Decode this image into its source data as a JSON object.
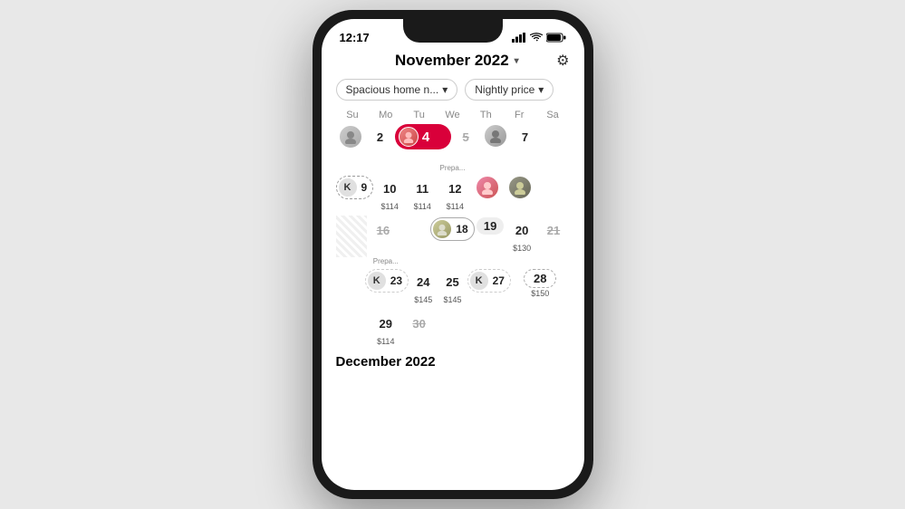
{
  "phone": {
    "status_bar": {
      "time": "12:17",
      "signal": "▐▐▐",
      "wifi": "wifi",
      "battery": "battery"
    },
    "header": {
      "month_title": "November 2022",
      "chevron": "ᵛ",
      "gear_label": "⚙"
    },
    "filters": [
      {
        "label": "Spacious home n...",
        "chevron": "∨"
      },
      {
        "label": "Nightly price",
        "chevron": "∨"
      }
    ],
    "calendar_headers": [
      "Su",
      "Mo",
      "Tu",
      "We",
      "Th",
      "Fr",
      "Sa"
    ],
    "december_label": "December 2022",
    "weeks": [
      {
        "type": "row1",
        "cells": [
          {
            "day": "",
            "type": "avatar",
            "avatar_color": "#bbb"
          },
          {
            "day": "2",
            "type": "normal"
          },
          {
            "day": "4",
            "type": "active",
            "avatar": true
          },
          {
            "day": "5",
            "type": "strikethrough"
          },
          {
            "day": "",
            "type": "avatar-right",
            "avatar_color": "#bbb"
          },
          {
            "day": "7",
            "type": "normal"
          },
          {
            "day": "",
            "type": "empty"
          }
        ]
      }
    ],
    "rows": {
      "row_week1_sub": {
        "label": "Prepa...",
        "col": 4
      },
      "week2": [
        {
          "day": "9",
          "type": "avatar-pill-dashed",
          "letter": "K"
        },
        {
          "day": "10",
          "type": "normal",
          "price": "$114"
        },
        {
          "day": "11",
          "type": "normal",
          "price": "$114"
        },
        {
          "day": "12",
          "type": "normal",
          "price": "$114"
        },
        {
          "day": "",
          "type": "avatar",
          "avatar_color": "#d4a"
        },
        {
          "day": "",
          "type": "avatar-end",
          "avatar_color": "#884"
        },
        {
          "day": "",
          "type": "empty"
        }
      ],
      "week3": [
        {
          "day": "16",
          "type": "strikethrough"
        },
        {
          "day": "18",
          "type": "pill-avatar-start",
          "letter": ""
        },
        {
          "day": "19",
          "type": "pill-mid"
        },
        {
          "day": "20",
          "type": "normal",
          "price": "$130"
        },
        {
          "day": "21",
          "type": "strikethrough"
        }
      ],
      "week3_sub": {
        "label": "Prepa...",
        "col": 1
      },
      "week4": [
        {
          "day": "23",
          "type": "dashed-pill-start",
          "letter": "K"
        },
        {
          "day": "24",
          "type": "normal",
          "price": "$145"
        },
        {
          "day": "25",
          "type": "normal",
          "price": "$145"
        },
        {
          "day": "27",
          "type": "dashed-pill-mid",
          "letter": "K"
        },
        {
          "day": "28",
          "type": "normal",
          "price": "$150"
        }
      ],
      "week5": [
        {
          "day": "29",
          "type": "normal",
          "price": "$114"
        },
        {
          "day": "30",
          "type": "strikethrough"
        }
      ]
    }
  }
}
